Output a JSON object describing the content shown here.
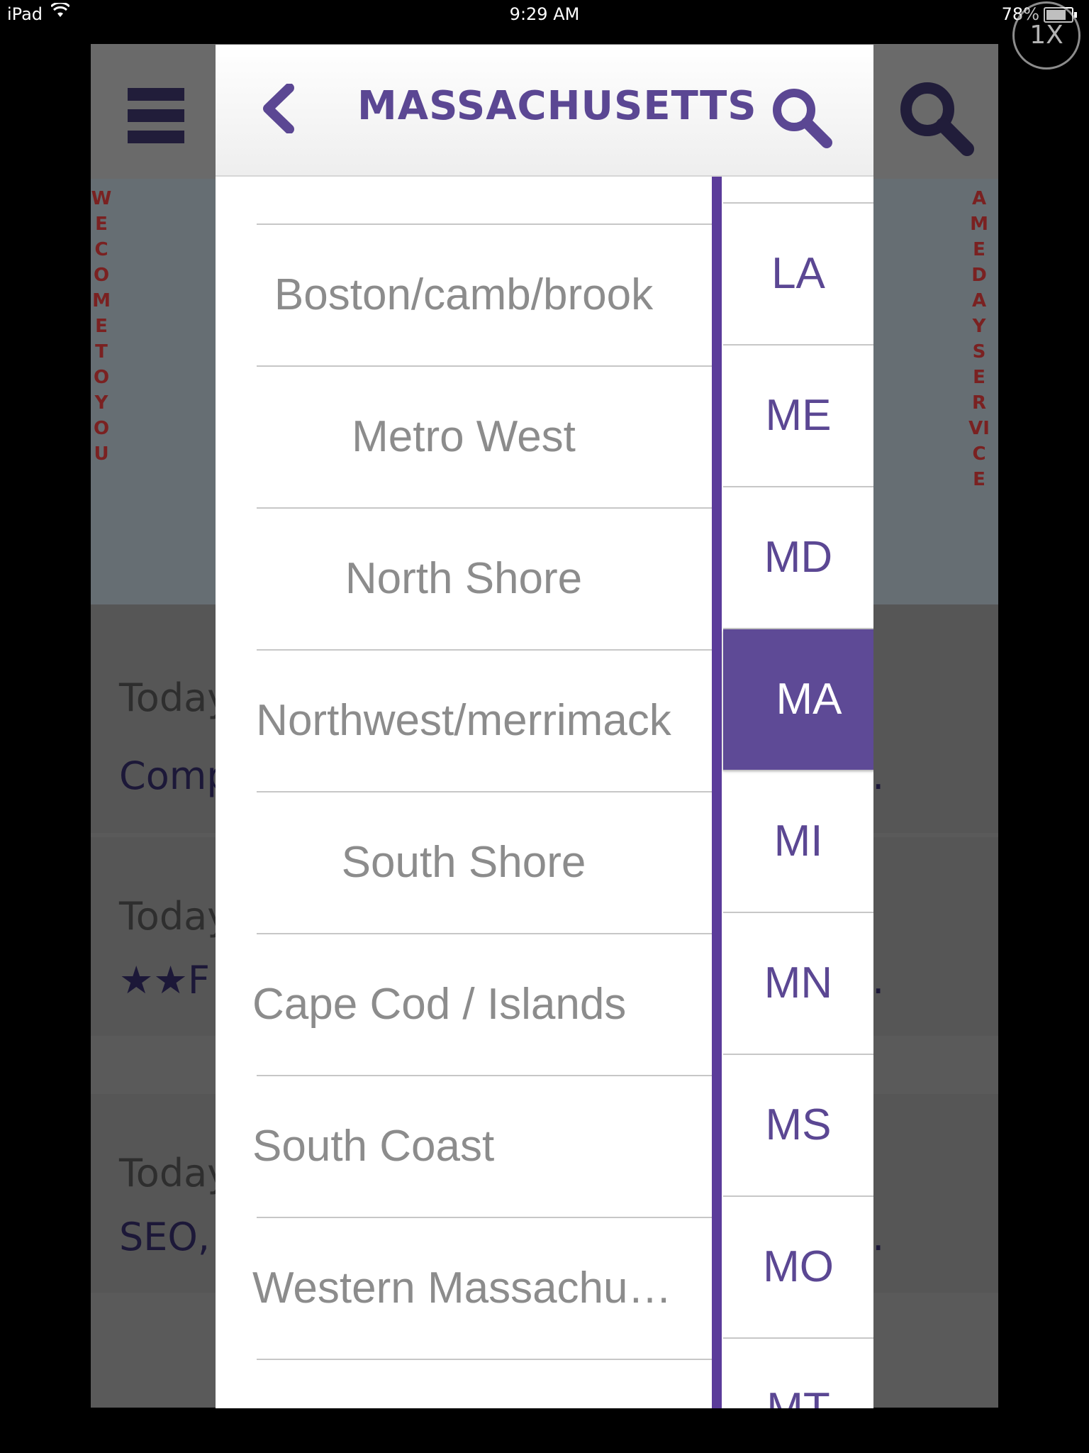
{
  "status_bar": {
    "device": "iPad",
    "time": "9:29 AM",
    "battery": "78%"
  },
  "zoom_badge": "1X",
  "background_app": {
    "banner_left_text": "WE COME TO YOU",
    "banner_right_text": "AME DAY SERVICE",
    "cards": [
      {
        "date": "Today",
        "title": "Comp",
        "trail": ".."
      },
      {
        "date": "Today",
        "title": "★★F",
        "trail": ".."
      },
      {
        "date": "Today",
        "title": "SEO,",
        "trail": ".."
      }
    ]
  },
  "popover": {
    "title": "MASSACHUSETTS",
    "regions": [
      "Boston/camb/brook",
      "Metro West",
      "North Shore",
      "Northwest/merrimack",
      "South Shore",
      "Cape Cod / Islands",
      "South Coast",
      "Western Massachu…"
    ],
    "states": [
      "LA",
      "ME",
      "MD",
      "MA",
      "MI",
      "MN",
      "MS",
      "MO",
      "MT"
    ],
    "selected_state": "MA"
  },
  "colors": {
    "accent": "#5b4793",
    "selected_bg": "#5e4a96",
    "region_text": "#8c8c8c"
  }
}
